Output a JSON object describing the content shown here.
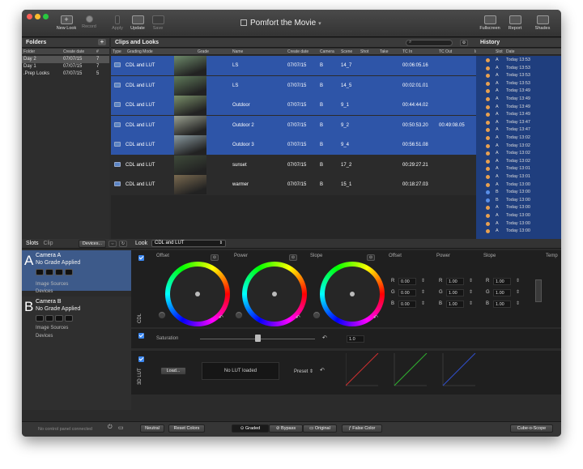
{
  "toolbar": {
    "doc_title": "Pomfort the Movie",
    "new_look": "New Look",
    "record": "Record",
    "apply": "Apply",
    "update": "Update",
    "save": "Save",
    "fullscreen": "Fullscreen",
    "report": "Report",
    "shades": "Shades"
  },
  "folders": {
    "title": "Folders",
    "columns": [
      "Folder",
      "Create date",
      "#"
    ],
    "rows": [
      {
        "name": "Day 2",
        "date": "07/07/15",
        "count": "7",
        "selected": true
      },
      {
        "name": "Day 1",
        "date": "07/07/15",
        "count": "7",
        "selected": false
      },
      {
        "name": ".Prep Looks",
        "date": "07/07/15",
        "count": "5",
        "selected": false
      }
    ]
  },
  "clips": {
    "title": "Clips and Looks",
    "columns": [
      "Type",
      "Grading Mode",
      "Grade",
      "Name",
      "Create date",
      "Camera",
      "Scene",
      "Shot",
      "Take",
      "TC In",
      "TC Out",
      "Image Sour..."
    ],
    "rows": [
      {
        "mode": "CDL and LUT",
        "name": "LS",
        "date": "07/07/15",
        "camera": "B",
        "scene": "14_7",
        "tc_in": "00:06:05.16",
        "tc_out": "",
        "selected": true,
        "thumb": "#6d8a6a"
      },
      {
        "mode": "CDL and LUT",
        "name": "LS",
        "date": "07/07/15",
        "camera": "B",
        "scene": "14_5",
        "tc_in": "00:02:01.01",
        "tc_out": "",
        "selected": true,
        "thumb": "#5f7a5a"
      },
      {
        "mode": "CDL and LUT",
        "name": "Outdoor",
        "date": "07/07/15",
        "camera": "B",
        "scene": "9_1",
        "tc_in": "00:44:44.02",
        "tc_out": "",
        "selected": true,
        "thumb": "#7a8f6a"
      },
      {
        "mode": "CDL and LUT",
        "name": "Outdoor 2",
        "date": "07/07/15",
        "camera": "B",
        "scene": "9_2",
        "tc_in": "00:50:53.20",
        "tc_out": "00:49:08.05",
        "selected": true,
        "thumb": "#9aa090"
      },
      {
        "mode": "CDL and LUT",
        "name": "Outdoor 3",
        "date": "07/07/15",
        "camera": "B",
        "scene": "9_4",
        "tc_in": "00:56:51.08",
        "tc_out": "",
        "selected": true,
        "thumb": "#8a9aa0"
      },
      {
        "mode": "CDL and LUT",
        "name": "sunset",
        "date": "07/07/15",
        "camera": "B",
        "scene": "17_2",
        "tc_in": "00:29:27.21",
        "tc_out": "",
        "selected": false,
        "thumb": "#3e4a3a"
      },
      {
        "mode": "CDL and LUT",
        "name": "warmer",
        "date": "07/07/15",
        "camera": "B",
        "scene": "15_1",
        "tc_in": "00:18:27.03",
        "tc_out": "",
        "selected": false,
        "thumb": "#7a6a50"
      }
    ]
  },
  "history": {
    "title": "History",
    "columns": [
      "Slot",
      "Date"
    ],
    "rows": [
      {
        "slot": "A",
        "date": "Today 13:53",
        "color": "#e8a050"
      },
      {
        "slot": "A",
        "date": "Today 13:53",
        "color": "#e8a050"
      },
      {
        "slot": "A",
        "date": "Today 13:53",
        "color": "#e8a050"
      },
      {
        "slot": "A",
        "date": "Today 13:53",
        "color": "#e8a050"
      },
      {
        "slot": "A",
        "date": "Today 13:49",
        "color": "#e8a050"
      },
      {
        "slot": "A",
        "date": "Today 13:49",
        "color": "#e8a050"
      },
      {
        "slot": "A",
        "date": "Today 13:49",
        "color": "#e8a050"
      },
      {
        "slot": "A",
        "date": "Today 13:49",
        "color": "#e8a050"
      },
      {
        "slot": "A",
        "date": "Today 13:47",
        "color": "#e8a050"
      },
      {
        "slot": "A",
        "date": "Today 13:47",
        "color": "#e8a050"
      },
      {
        "slot": "A",
        "date": "Today 13:02",
        "color": "#e8a050"
      },
      {
        "slot": "A",
        "date": "Today 13:02",
        "color": "#e8a050"
      },
      {
        "slot": "A",
        "date": "Today 13:02",
        "color": "#e8a050"
      },
      {
        "slot": "A",
        "date": "Today 13:02",
        "color": "#e8a050"
      },
      {
        "slot": "A",
        "date": "Today 13:01",
        "color": "#e8a050"
      },
      {
        "slot": "A",
        "date": "Today 13:01",
        "color": "#e8a050"
      },
      {
        "slot": "A",
        "date": "Today 13:00",
        "color": "#e8a050"
      },
      {
        "slot": "B",
        "date": "Today 13:00",
        "color": "#5a8fe8"
      },
      {
        "slot": "B",
        "date": "Today 13:00",
        "color": "#5a8fe8"
      },
      {
        "slot": "A",
        "date": "Today 13:00",
        "color": "#e8a050"
      },
      {
        "slot": "A",
        "date": "Today 13:00",
        "color": "#e8a050"
      },
      {
        "slot": "A",
        "date": "Today 13:00",
        "color": "#e8a050"
      },
      {
        "slot": "A",
        "date": "Today 13:00",
        "color": "#e8a050"
      }
    ]
  },
  "slots": {
    "tab_slots": "Slots",
    "tab_clip": "Clip",
    "devices_btn": "Devices...",
    "cameras": [
      {
        "letter": "A",
        "name": "Camera A",
        "grade": "No Grade Applied",
        "image_sources": "Image Sources",
        "devices": "Devices",
        "selected": true
      },
      {
        "letter": "B",
        "name": "Camera B",
        "grade": "No Grade Applied",
        "image_sources": "Image Sources",
        "devices": "Devices",
        "selected": false
      }
    ]
  },
  "look": {
    "label": "Look",
    "mode": "CDL and LUT",
    "cdl_label": "CDL",
    "wheels": [
      "Offset",
      "Power",
      "Slope"
    ],
    "offset_header": "Offset",
    "power_header": "Power",
    "slope_header": "Slope",
    "temp_header": "Temp",
    "offset": {
      "r": "0.00",
      "g": "0.00",
      "b": "0.00"
    },
    "power": {
      "r": "1.00",
      "g": "1.00",
      "b": "1.00"
    },
    "slope": {
      "r": "1.00",
      "g": "1.00",
      "b": "1.00"
    },
    "saturation_label": "Saturation",
    "saturation_value": "1.0",
    "saturation_fraction": 0.5,
    "lut_label": "3D LUT",
    "load_btn": "Load...",
    "no_lut": "No LUT loaded",
    "preset": "Preset"
  },
  "bottom": {
    "status": "No control panel connected",
    "neutral": "Neutral",
    "reset": "Reset Colors",
    "graded": "Graded",
    "bypass": "Bypass",
    "original": "Original",
    "false_color": "False Color",
    "scope": "Cube-o-Scope"
  }
}
